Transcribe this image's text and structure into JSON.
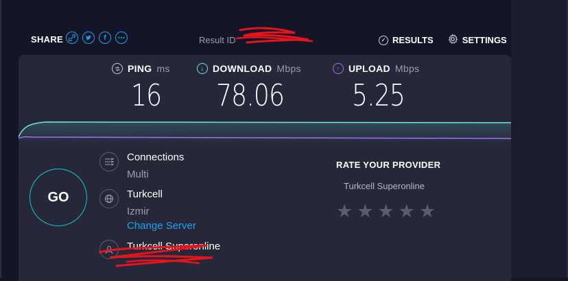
{
  "share": {
    "label": "SHARE",
    "icons": [
      "link-icon",
      "twitter-icon",
      "facebook-icon",
      "more-icon"
    ]
  },
  "result": {
    "label": "Result ID"
  },
  "nav": {
    "results": "RESULTS",
    "settings": "SETTINGS"
  },
  "metrics": {
    "ping": {
      "label": "PING",
      "unit": "ms",
      "value": "16"
    },
    "download": {
      "label": "DOWNLOAD",
      "unit": "Mbps",
      "value": "78.06"
    },
    "upload": {
      "label": "UPLOAD",
      "unit": "Mbps",
      "value": "5.25"
    }
  },
  "go": {
    "label": "GO"
  },
  "connections": {
    "title": "Connections",
    "value": "Multi"
  },
  "server": {
    "name": "Turkcell",
    "location": "Izmir",
    "change": "Change Server"
  },
  "isp": {
    "name": "Turkcell Superonline"
  },
  "rate": {
    "title": "RATE YOUR PROVIDER",
    "provider": "Turkcell Superonline",
    "stars": 5
  },
  "colors": {
    "download": "#6ae8e2",
    "upload": "#a36ff2",
    "accent": "#1aa3f4",
    "go_ring": "#13c8d6",
    "redaction": "#e8141b"
  }
}
